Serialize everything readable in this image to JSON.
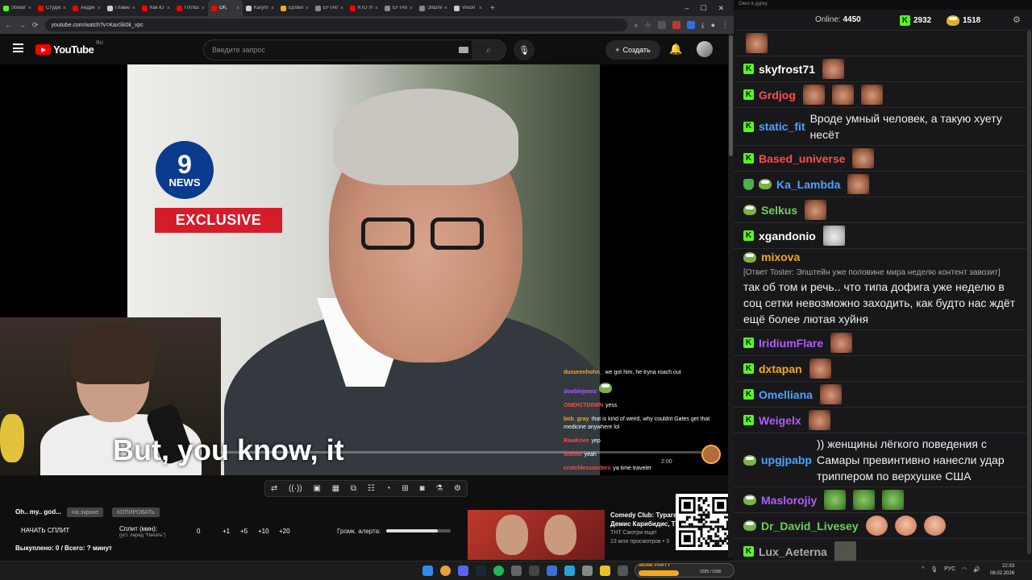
{
  "browser": {
    "tabs": [
      {
        "label": "Stream",
        "color": "#53fc18"
      },
      {
        "label": "Студия",
        "color": "#ff0000"
      },
      {
        "label": "Андрей",
        "color": "#ff0000"
      },
      {
        "label": "Главна",
        "color": "#cccccc"
      },
      {
        "label": "Как Ю",
        "color": "#ff0000"
      },
      {
        "label": "ПУЛЬС",
        "color": "#ff0000"
      },
      {
        "label": "Oh,",
        "color": "#ff0000",
        "active": true
      },
      {
        "label": "Karyrn",
        "color": "#cccccc"
      },
      {
        "label": "Epstein",
        "color": "#f5a623"
      },
      {
        "label": "EFTA01",
        "color": "#888888"
      },
      {
        "label": "КТО УЕ",
        "color": "#ff0000"
      },
      {
        "label": "EFTA01",
        "color": "#888888"
      },
      {
        "label": "Эпште",
        "color": "#888888"
      },
      {
        "label": "Vision",
        "color": "#cccccc"
      }
    ],
    "url": "youtube.com/watch?v=KaxSk0k_vpc"
  },
  "youtube": {
    "region": "RU",
    "logo_text": "YouTube",
    "search_placeholder": "Введите запрос",
    "create_label": "Создать"
  },
  "video": {
    "channel_logo": "9",
    "channel_logo_sub": "NEWS",
    "banner": "EXCLUSIVE",
    "subtitle": "But, you know, it",
    "time": "2:00",
    "overlay_chat": [
      {
        "user": "dusurenhohn_",
        "color": "#f5a623",
        "text": "we got him, he tryna roach out"
      },
      {
        "user": "doobiejonez",
        "color": "#b05cff",
        "text": ""
      },
      {
        "user": "ONEH1TD0WN",
        "color": "#ff4b4b",
        "text": "yess"
      },
      {
        "user": "bob_gray",
        "color": "#f5a623",
        "text": "that is kind of weird, why couldnt Gates get that medicine anywhere lol"
      },
      {
        "user": "RawKnee",
        "color": "#ff4b4b",
        "text": "yep"
      },
      {
        "user": "linthiel",
        "color": "#ff4b4b",
        "text": "yeah"
      },
      {
        "user": "crotchlessunders",
        "color": "#ff4b4b",
        "text": "ya time traveler"
      }
    ]
  },
  "toolbar_icons": [
    "loop-icon",
    "audio-icon",
    "screenshot-icon",
    "clip-icon",
    "pip-icon",
    "subtitles-icon",
    "speed-icon",
    "add-icon",
    "camera-icon",
    "lab-icon",
    "settings-icon"
  ],
  "panel": {
    "title": "Oh.. my.. god...",
    "btn_live": "На экране",
    "btn_copy": "КОПИРОВАТЬ",
    "start_split": "НАЧАТЬ СПЛИТ",
    "split_label": "Сплит (мин):",
    "split_sub": "(уст. перед \"Начать\")",
    "split_value": "0",
    "steps": [
      "+1",
      "+5",
      "+10",
      "+20"
    ],
    "alert_label": "Громк. алерта:",
    "alert_volume": 0.8,
    "bought": "Выкуплено: 0 / Всего: ? минут"
  },
  "recommendation": {
    "title": "Comedy Club: Турагент",
    "subtitle": "Демис Карибидис, Т",
    "channel": "ТНТ Смотри еще!",
    "views": "13 млн просмотров • 3"
  },
  "chat": {
    "window_title": "Окно в дурку",
    "online_label": "Online:",
    "online_count": "4450",
    "kick_count": "2932",
    "pepe_count": "1518",
    "messages": [
      {
        "nick": "",
        "color": "#ffffff",
        "badges": [],
        "text": "",
        "emotes": [
          "face"
        ]
      },
      {
        "nick": "skyfrost71",
        "color": "#ffffff",
        "badges": [
          "kick"
        ],
        "text": "",
        "emotes": [
          "face"
        ]
      },
      {
        "nick": "Grdjog",
        "color": "#ff4b4b",
        "badges": [
          "kick"
        ],
        "text": "",
        "emotes": [
          "face",
          "face",
          "face"
        ]
      },
      {
        "nick": "static_fit",
        "color": "#4aa3ff",
        "badges": [
          "kick"
        ],
        "text": "Вроде умный человек, а такую хуету несёт",
        "emotes": []
      },
      {
        "nick": "Based_universe",
        "color": "#ff4b4b",
        "badges": [
          "kick"
        ],
        "text": "",
        "emotes": [
          "face"
        ]
      },
      {
        "nick": "Ka_Lambda",
        "color": "#4aa3ff",
        "badges": [
          "shield",
          "pepe"
        ],
        "text": "",
        "emotes": [
          "face"
        ]
      },
      {
        "nick": "Selkus",
        "color": "#6fcf57",
        "badges": [
          "pepe"
        ],
        "text": "",
        "emotes": [
          "face"
        ]
      },
      {
        "nick": "xgandonio",
        "color": "#ffffff",
        "badges": [
          "kick"
        ],
        "text": "",
        "emotes": [
          "cat"
        ]
      },
      {
        "nick": "mixova",
        "color": "#f5a623",
        "badges": [
          "pepe"
        ],
        "reply": "[Ответ Toster: Эпштейн уже половине мира неделю контент завозит]",
        "text": "так об том и речь.. что типа дофига уже неделю  в соц сетки невозможно  заходить, как будто нас ждёт ещё более лютая хуйня",
        "emotes": []
      },
      {
        "nick": "IridiumFlare",
        "color": "#b05cff",
        "badges": [
          "kick"
        ],
        "text": "",
        "emotes": [
          "face"
        ]
      },
      {
        "nick": "dxtapan",
        "color": "#f5a623",
        "badges": [
          "kick"
        ],
        "text": "",
        "emotes": [
          "face"
        ]
      },
      {
        "nick": "Omelliana",
        "color": "#4aa3ff",
        "badges": [
          "kick"
        ],
        "text": "",
        "emotes": [
          "face"
        ]
      },
      {
        "nick": "Weigelx",
        "color": "#b05cff",
        "badges": [
          "kick"
        ],
        "text": "",
        "emotes": [
          "face"
        ]
      },
      {
        "nick": "upgjpabp",
        "color": "#4aa3ff",
        "badges": [
          "pepe"
        ],
        "text": ")) женщины лёгкого поведения  с Самары превинтивно нанесли удар триппером по верхушке США",
        "emotes": []
      },
      {
        "nick": "Maslorojiy",
        "color": "#b05cff",
        "badges": [
          "pepe"
        ],
        "text": "",
        "emotes": [
          "frog",
          "frog",
          "frog"
        ]
      },
      {
        "nick": "Dr_David_Livesey",
        "color": "#6fcf57",
        "badges": [
          "pepe"
        ],
        "text": "",
        "emotes": [
          "egg",
          "egg",
          "egg"
        ]
      },
      {
        "nick": "Lux_Aeterna",
        "color": "#aaaaaa",
        "badges": [
          "kick"
        ],
        "text": "",
        "emotes": [
          "blur"
        ]
      }
    ]
  },
  "taskbar": {
    "meme_label": "MEME PARTY",
    "meme_count": "1025 / 1500",
    "meme_progress": 0.68,
    "lang": "РУС",
    "time": "22:33",
    "date": "08.02.2026"
  }
}
